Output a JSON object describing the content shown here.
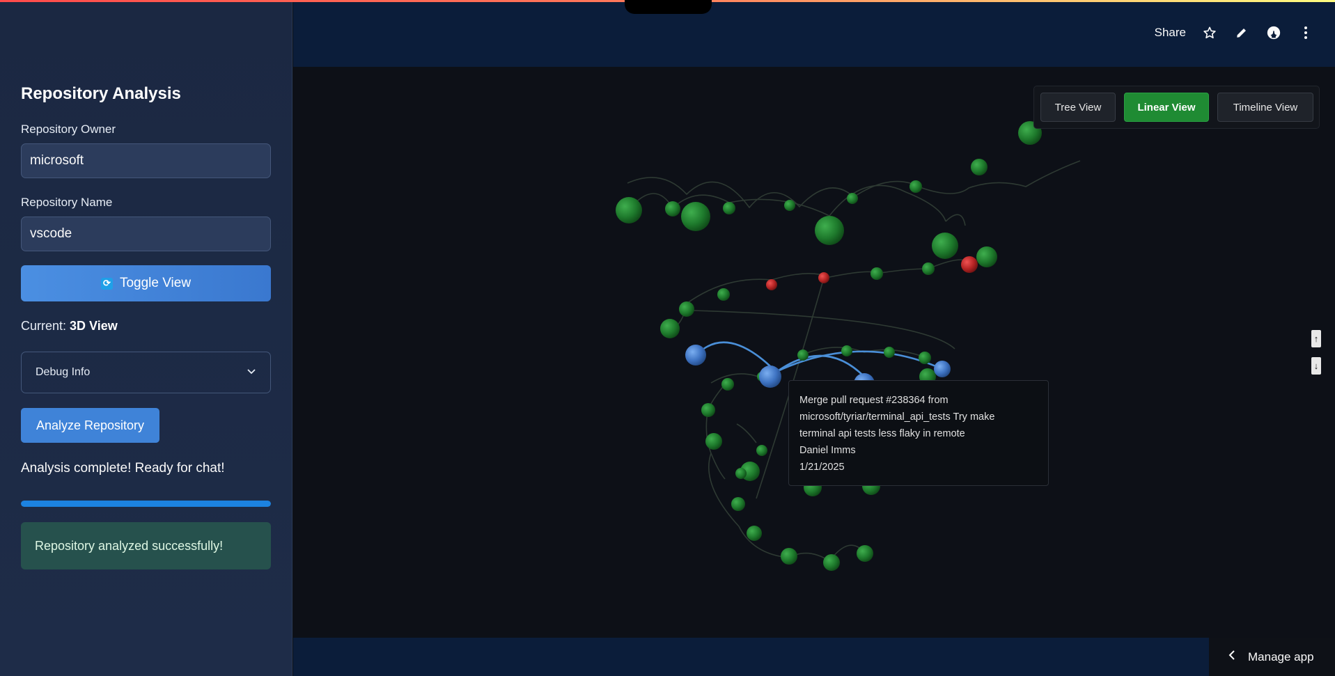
{
  "sidebar": {
    "heading": "Repository Analysis",
    "owner_label": "Repository Owner",
    "owner_value": "microsoft",
    "name_label": "Repository Name",
    "name_value": "vscode",
    "toggle_label": "Toggle View",
    "current_prefix": "Current:",
    "current_value": "3D View",
    "debug_label": "Debug Info",
    "analyze_label": "Analyze Repository",
    "status_text": "Analysis complete! Ready for chat!",
    "progress": 1.0,
    "success_text": "Repository analyzed successfully!"
  },
  "header": {
    "share_label": "Share",
    "icons": [
      "star-icon",
      "pencil-icon",
      "github-icon",
      "more-vertical-icon"
    ]
  },
  "view_buttons": {
    "tree": "Tree View",
    "linear": "Linear View",
    "timeline": "Timeline View",
    "active": "linear"
  },
  "tooltip": {
    "line1": "Merge pull request #238364 from",
    "line2": "microsoft/tyriar/terminal_api_tests Try make",
    "line3": "terminal api tests less flaky in remote",
    "author": "Daniel Imms",
    "date": "1/21/2025"
  },
  "scroll": {
    "up": "↑",
    "down": "↓"
  },
  "footer": {
    "manage_label": "Manage app"
  },
  "colors": {
    "node_green": "#1f7a2e",
    "node_red": "#c62a2a",
    "node_blue": "#3f74c0",
    "highlight_edge": "#4a8fd8",
    "accent_button": "#1f8b33"
  }
}
